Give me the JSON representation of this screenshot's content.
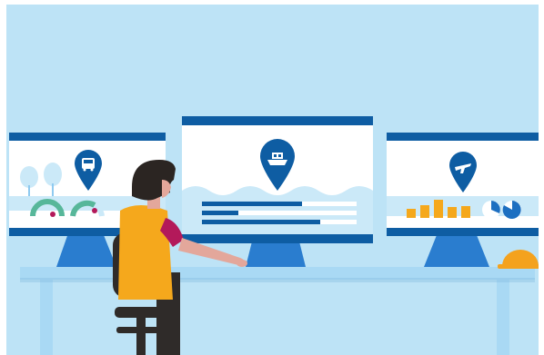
{
  "scene": {
    "background": "#bde3f6",
    "frame": "#ffffff"
  },
  "colors": {
    "dark_blue": "#0e5da3",
    "mid_blue": "#2a7dcf",
    "light_blue": "#8fcaf0",
    "pale_blue": "#cbe9f8",
    "desk": "#a9d9f4",
    "worker_vest": "#f5a81c",
    "skin": "#e3a79b",
    "sleeve": "#b3195a",
    "hair": "#2b2522",
    "chair": "#2f2b29",
    "hard_hat": "#f4a21e",
    "gauge_green": "#57b79a",
    "gauge_red": "#b3195a",
    "pie_blue": "#1d6fc1"
  },
  "monitors": [
    {
      "name": "left-monitor",
      "icon": "bus-icon",
      "content": "park-and-gauges"
    },
    {
      "name": "center-monitor",
      "icon": "ferry-icon",
      "content": "waves-and-text-lines"
    },
    {
      "name": "right-monitor",
      "icon": "airplane-icon",
      "content": "bar-chart-and-pies"
    }
  ],
  "objects": [
    "desk",
    "office-chair",
    "worker-with-hard-hat-vest",
    "hard-hat"
  ]
}
